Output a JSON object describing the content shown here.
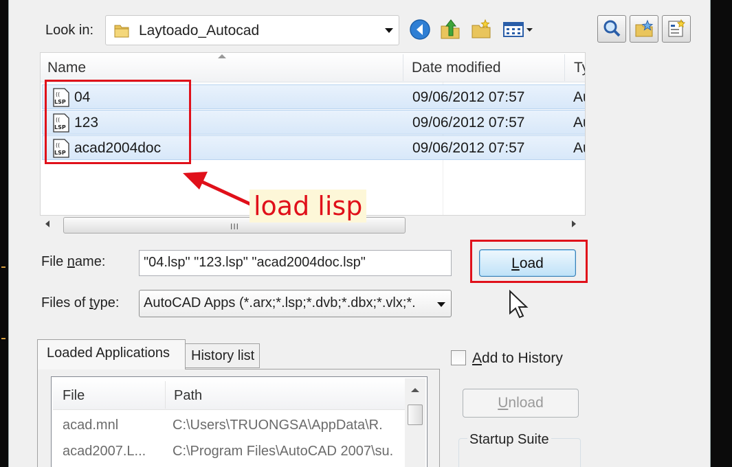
{
  "look_in": {
    "label": "Look in:",
    "value": "Laytoado_Autocad"
  },
  "toolbar": {
    "icons": [
      "back-icon",
      "up-folder-icon",
      "new-folder-icon",
      "views-icon"
    ],
    "tool_buttons": [
      "find-icon",
      "locate-icon",
      "add-favorite-icon"
    ]
  },
  "file_list": {
    "columns": [
      "Name",
      "Date modified",
      "Ty"
    ],
    "rows": [
      {
        "name": "04",
        "date": "09/06/2012 07:57",
        "type": "Au"
      },
      {
        "name": "123",
        "date": "09/06/2012 07:57",
        "type": "Au"
      },
      {
        "name": "acad2004doc",
        "date": "09/06/2012 07:57",
        "type": "Au"
      }
    ],
    "scroll_grip": "III"
  },
  "annotation": {
    "text": "load lisp"
  },
  "file_name": {
    "label_pre": "File ",
    "label_u": "n",
    "label_post": "ame:",
    "value": "\"04.lsp\" \"123.lsp\" \"acad2004doc.lsp\""
  },
  "files_of_type": {
    "label_pre": "Files of ",
    "label_u": "t",
    "label_post": "ype:",
    "value": "AutoCAD Apps (*.arx;*.lsp;*.dvb;*.dbx;*.vlx;*."
  },
  "load_button": {
    "u": "L",
    "rest": "oad"
  },
  "tabs": [
    {
      "label": "Loaded Applications"
    },
    {
      "label": "History list"
    }
  ],
  "loaded_apps": {
    "columns": [
      "File",
      "Path"
    ],
    "rows": [
      {
        "file": "acad.mnl",
        "path": "C:\\Users\\TRUONGSA\\AppData\\R."
      },
      {
        "file": "acad2007.L...",
        "path": "C:\\Program Files\\AutoCAD 2007\\su."
      }
    ]
  },
  "add_to_history": {
    "u": "A",
    "rest": "dd to History",
    "checked": false
  },
  "unload_button": {
    "u": "U",
    "rest": "nload"
  },
  "startup_suite": {
    "label": "Startup Suite"
  },
  "colors": {
    "highlight": "#e0101a",
    "selection": "#d8e8f9",
    "accent_button": "#bfe2f8"
  }
}
